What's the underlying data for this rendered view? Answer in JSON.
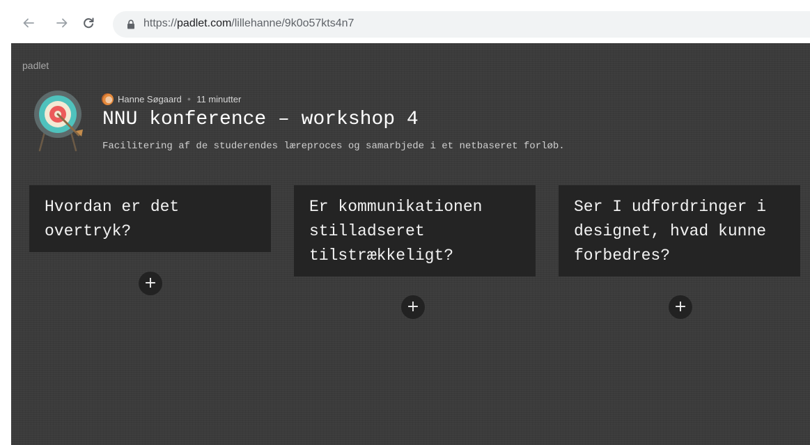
{
  "browser": {
    "url_scheme": "https://",
    "url_host": "padlet.com",
    "url_path": "/lillehanne/9k0o57kts4n7",
    "icons": [
      "back-arrow-icon",
      "forward-arrow-icon",
      "reload-icon",
      "lock-icon"
    ]
  },
  "padlet": {
    "brand": "padlet",
    "author": "Hanne Søgaard",
    "time_ago": "11 minutter",
    "title": "NNU konference – workshop 4",
    "subtitle": "Facilitering af de studerendes læreproces og samarbjede i et netbaseret forløb.",
    "columns": [
      {
        "header": "Hvordan er det overtryk?",
        "add_symbol": "+"
      },
      {
        "header": "Er kommunikationen stilladseret tilstrækkeligt?",
        "add_symbol": "+"
      },
      {
        "header": "Ser I udfordringer i designet, hvad kunne forbedres?",
        "add_symbol": "+"
      }
    ]
  },
  "colors": {
    "background": "#3b3b3b",
    "card": "#242424",
    "add_button": "#222222",
    "text": "#f2f2f2"
  }
}
